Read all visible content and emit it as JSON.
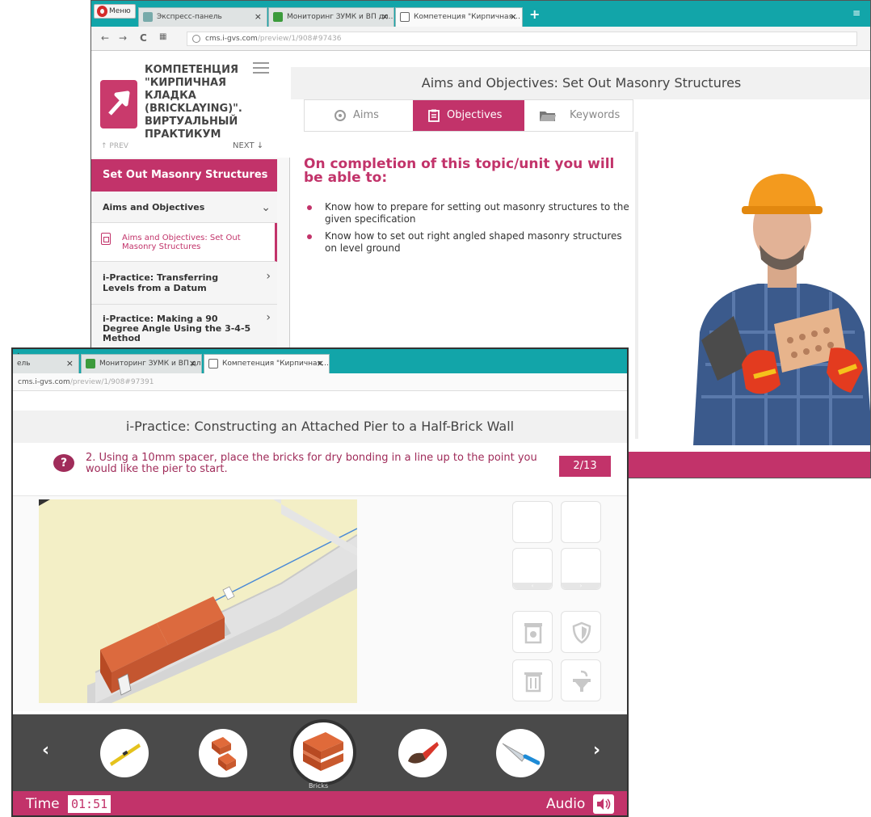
{
  "back_window": {
    "menu_label": "Меню",
    "tabs": [
      {
        "label": "Экспресс-панель",
        "close": "×"
      },
      {
        "label": "Мониторинг ЗУМК и ВП дл…",
        "close": "×"
      },
      {
        "label": "Компетенция \"Кирпичная…",
        "close": "×"
      }
    ],
    "new_tab": "+",
    "url_host": "cms.i-gvs.com",
    "url_path": "/preview/1/908#97436",
    "course_title": "КОМПЕТЕНЦИЯ \"КИРПИЧНАЯ КЛАДКА (BRICKLAYING)\". ВИРТУАЛЬНЫЙ ПРАКТИКУМ",
    "prev_label": "↑ PREV",
    "next_label": "NEXT ↓",
    "section_title": "Set Out Masonry Structures",
    "nav_items": [
      {
        "label": "Aims and Objectives"
      },
      {
        "label": "Aims and Objectives: Set Out Masonry Structures"
      },
      {
        "label": "i-Practice: Transferring Levels from a Datum"
      },
      {
        "label": "i-Practice: Making a 90 Degree Angle Using the 3-4-5 Method"
      }
    ],
    "page_title": "Aims and Objectives: Set Out Masonry Structures",
    "content_tabs": [
      {
        "label": "Aims"
      },
      {
        "label": "Objectives"
      },
      {
        "label": "Keywords"
      }
    ],
    "heading": "On completion of this topic/unit you will be able to:",
    "objectives": [
      "Know how to prepare for setting out masonry structures to the given specification",
      "Know how to set out right angled shaped masonry structures on level ground"
    ]
  },
  "front_window": {
    "tabs": [
      {
        "label": "ель",
        "close": "×"
      },
      {
        "label": "Мониторинг ЗУМК и ВП дл…",
        "close": "×"
      },
      {
        "label": "Компетенция \"Кирпичная…",
        "close": "×"
      }
    ],
    "new_tab": "+",
    "url_host": "cms.i-gvs.com",
    "url_path": "/preview/1/908#97391",
    "page_title": "i-Practice: Constructing an Attached Pier to a Half-Brick Wall",
    "question_icon": "?",
    "question": "2. Using a 10mm spacer, place the bricks for dry bonding in a line up to the point you would like the pier to start.",
    "step_counter": "2/13",
    "slot_scroll_left": "‹",
    "slot_scroll_right": "›",
    "tools_prev": "‹",
    "tools_next": "›",
    "selected_tool_label": "Bricks",
    "time_label": "Time",
    "time_value": "01:51",
    "audio_label": "Audio"
  },
  "colors": {
    "brand": "#c2336a",
    "browser_tabbar": "#12a5a9",
    "toolbar": "#4a4a4a"
  },
  "icons": [
    "target-icon",
    "clipboard-icon",
    "folder-icon",
    "question-icon",
    "recycle-bin-icon",
    "shield-icon",
    "trash-icon",
    "sink-icon",
    "spirit-level-icon",
    "bricks-icon",
    "brush-icon",
    "trowel-icon",
    "audio-icon"
  ]
}
